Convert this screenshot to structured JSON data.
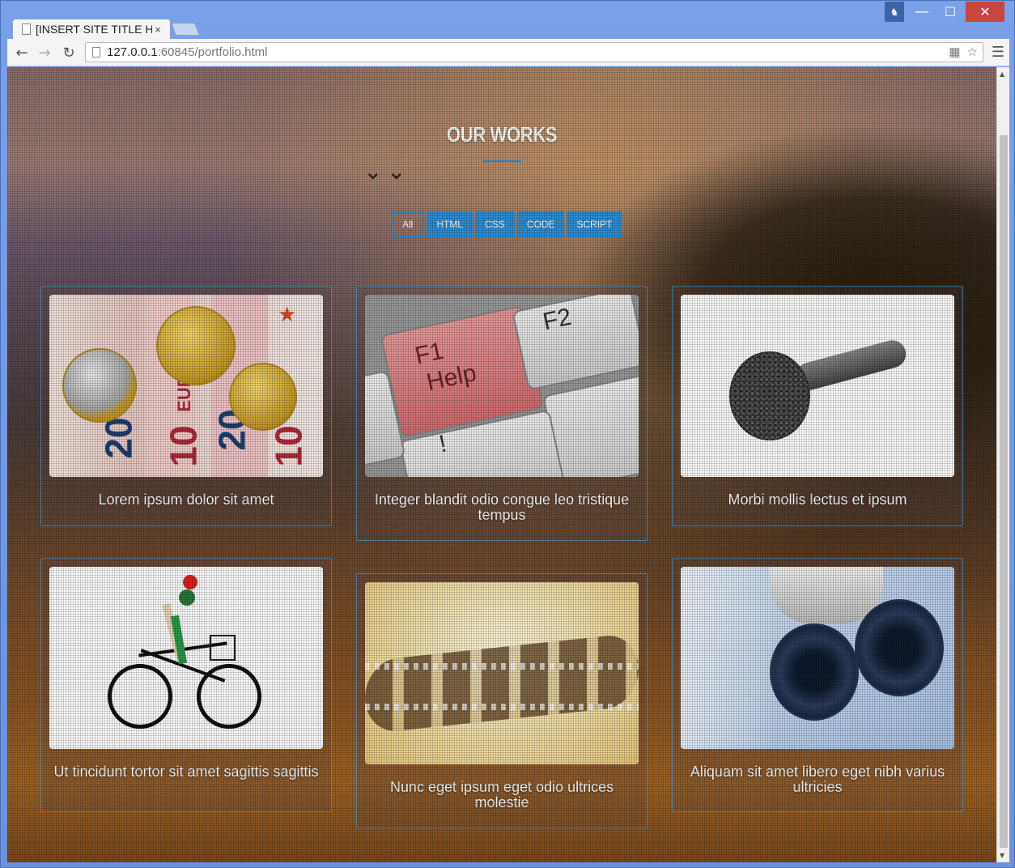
{
  "browser": {
    "tab_title": "[INSERT SITE TITLE H",
    "tab_close": "×",
    "url_host": "127.0.0.1",
    "url_rest": ":60845/portfolio.html"
  },
  "page": {
    "title": "OUR WORKS",
    "filters": [
      {
        "label": "All",
        "active": true
      },
      {
        "label": "HTML",
        "active": false
      },
      {
        "label": "CSS",
        "active": false
      },
      {
        "label": "CODE",
        "active": false
      },
      {
        "label": "SCRIPT",
        "active": false
      }
    ],
    "works": [
      {
        "caption": "Lorem ipsum dolor sit amet",
        "image": "euro-coins-banknotes"
      },
      {
        "caption": "Integer blandit odio congue leo tristique tempus",
        "image": "f1-help-key"
      },
      {
        "caption": "Morbi mollis lectus et ipsum",
        "image": "microphone"
      },
      {
        "caption": "Ut tincidunt tortor sit amet sagittis sagittis",
        "image": "wooden-figure-bicycle"
      },
      {
        "caption": "Nunc eget ipsum eget odio ultrices molestie",
        "image": "film-strip"
      },
      {
        "caption": "Aliquam sit amet libero eget nibh varius ultricies",
        "image": "microscope"
      }
    ],
    "image_text": {
      "f1": "F1",
      "help": "Help",
      "f2": "F2",
      "euro": "EURO",
      "n20": "20",
      "n10": "10",
      "excl": "!"
    }
  },
  "colors": {
    "accent": "#2f8fd4",
    "close": "#c9463d"
  }
}
